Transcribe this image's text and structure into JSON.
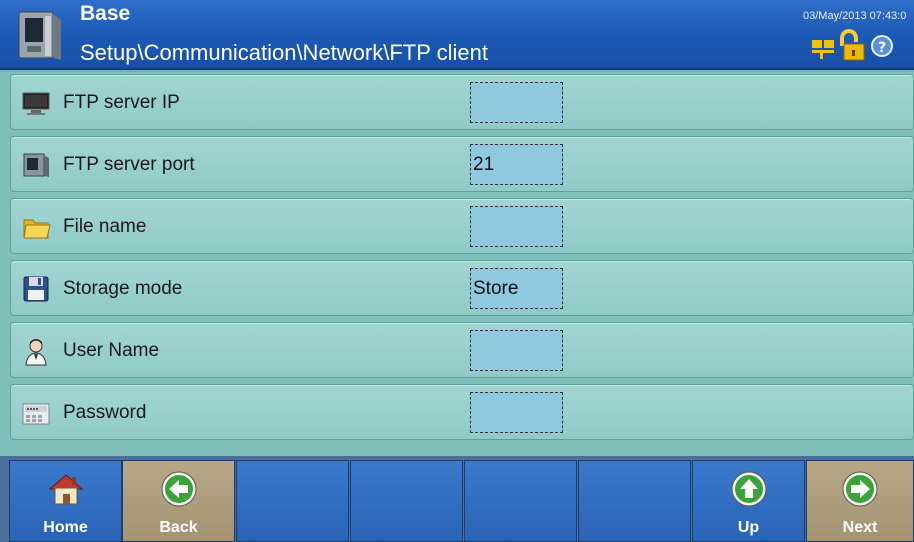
{
  "header": {
    "title": "Base",
    "path": "Setup\\Communication\\Network\\FTP client",
    "datetime": "03/May/2013 07:43:0"
  },
  "rows": [
    {
      "label": "FTP server IP",
      "value": "",
      "icon": "monitor-icon"
    },
    {
      "label": "FTP server port",
      "value": "21",
      "icon": "terminal-icon"
    },
    {
      "label": "File name",
      "value": "",
      "icon": "folder-icon"
    },
    {
      "label": "Storage mode",
      "value": "Store",
      "icon": "floppy-disk-icon"
    },
    {
      "label": "User Name",
      "value": "",
      "icon": "user-icon"
    },
    {
      "label": "Password",
      "value": "",
      "icon": "password-keypad-icon"
    }
  ],
  "softkeys": [
    {
      "label": "Home",
      "icon": "home-icon"
    },
    {
      "label": "Back",
      "icon": "back-arrow-icon"
    },
    {
      "label": "",
      "icon": ""
    },
    {
      "label": "",
      "icon": ""
    },
    {
      "label": "",
      "icon": ""
    },
    {
      "label": "",
      "icon": ""
    },
    {
      "label": "Up",
      "icon": "up-arrow-icon"
    },
    {
      "label": "Next",
      "icon": "next-arrow-icon"
    }
  ]
}
